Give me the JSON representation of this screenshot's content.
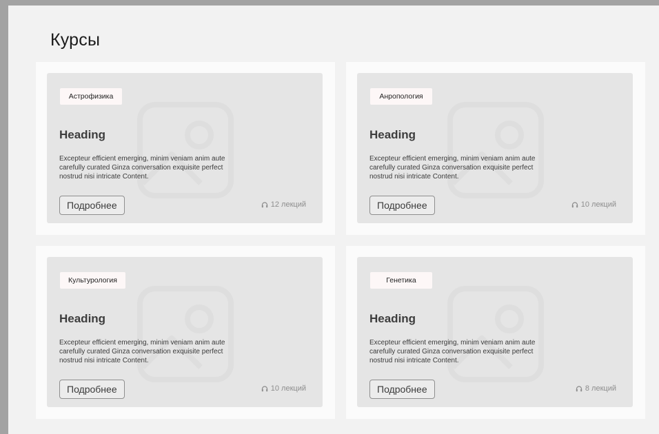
{
  "page": {
    "title": "Курсы"
  },
  "courses": [
    {
      "tag": "Астрофизика",
      "heading": "Heading",
      "description": "Excepteur efficient emerging, minim veniam anim aute carefully curated Ginza conversation exquisite perfect nostrud nisi intricate Content.",
      "button_label": "Подробнее",
      "lectures": "12 лекций"
    },
    {
      "tag": "Анропология",
      "heading": "Heading",
      "description": "Excepteur efficient emerging, minim veniam anim aute carefully curated Ginza conversation exquisite perfect nostrud nisi intricate Content.",
      "button_label": "Подробнее",
      "lectures": "10 лекций"
    },
    {
      "tag": "Культурология",
      "heading": "Heading",
      "description": "Excepteur efficient emerging, minim veniam anim aute carefully curated Ginza conversation exquisite perfect nostrud nisi intricate Content.",
      "button_label": "Подробнее",
      "lectures": "10 лекций"
    },
    {
      "tag": "Генетика",
      "heading": "Heading",
      "description": "Excepteur efficient emerging, minim veniam anim aute carefully curated Ginza conversation exquisite perfect nostrud nisi intricate Content.",
      "button_label": "Подробнее",
      "lectures": "8 лекций"
    }
  ],
  "icons": {
    "card_image": "image-placeholder-icon",
    "lectures": "headphones-icon"
  },
  "colors": {
    "background": "#a3a3a3",
    "page": "#f2f2f2",
    "panel": "#fbfbfb",
    "card": "#e5e5e5",
    "tag": "#fdf7f7",
    "button_border": "#8e8e8e",
    "muted_text": "#8d8d8d"
  }
}
